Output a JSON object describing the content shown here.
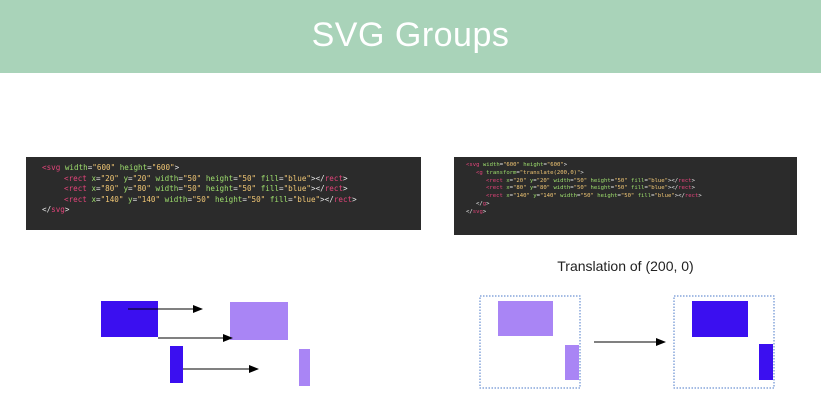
{
  "header": {
    "title": "SVG Groups"
  },
  "code_left": {
    "lines": [
      {
        "indent": 0,
        "tokens": [
          [
            "tag",
            "<svg "
          ],
          [
            "attr",
            "width"
          ],
          [
            "plain",
            "="
          ],
          [
            "val",
            "\"600\""
          ],
          [
            "plain",
            " "
          ],
          [
            "attr",
            "height"
          ],
          [
            "plain",
            "="
          ],
          [
            "val",
            "\"600\""
          ],
          [
            "plain",
            ">"
          ]
        ]
      },
      {
        "indent": 1,
        "tokens": [
          [
            "tag",
            "<rect "
          ],
          [
            "attr",
            "x"
          ],
          [
            "plain",
            "="
          ],
          [
            "val",
            "\"20\""
          ],
          [
            "plain",
            " "
          ],
          [
            "attr",
            "y"
          ],
          [
            "plain",
            "="
          ],
          [
            "val",
            "\"20\""
          ],
          [
            "plain",
            " "
          ],
          [
            "attr",
            "width"
          ],
          [
            "plain",
            "="
          ],
          [
            "val",
            "\"50\""
          ],
          [
            "plain",
            " "
          ],
          [
            "attr",
            "height"
          ],
          [
            "plain",
            "="
          ],
          [
            "val",
            "\"50\""
          ],
          [
            "plain",
            " "
          ],
          [
            "attr",
            "fill"
          ],
          [
            "plain",
            "="
          ],
          [
            "val",
            "\"blue\""
          ],
          [
            "plain",
            "></"
          ],
          [
            "tag",
            "rect"
          ],
          [
            "plain",
            ">"
          ]
        ]
      },
      {
        "indent": 1,
        "tokens": [
          [
            "tag",
            "<rect "
          ],
          [
            "attr",
            "x"
          ],
          [
            "plain",
            "="
          ],
          [
            "val",
            "\"80\""
          ],
          [
            "plain",
            " "
          ],
          [
            "attr",
            "y"
          ],
          [
            "plain",
            "="
          ],
          [
            "val",
            "\"80\""
          ],
          [
            "plain",
            " "
          ],
          [
            "attr",
            "width"
          ],
          [
            "plain",
            "="
          ],
          [
            "val",
            "\"50\""
          ],
          [
            "plain",
            " "
          ],
          [
            "attr",
            "height"
          ],
          [
            "plain",
            "="
          ],
          [
            "val",
            "\"50\""
          ],
          [
            "plain",
            " "
          ],
          [
            "attr",
            "fill"
          ],
          [
            "plain",
            "="
          ],
          [
            "val",
            "\"blue\""
          ],
          [
            "plain",
            "></"
          ],
          [
            "tag",
            "rect"
          ],
          [
            "plain",
            ">"
          ]
        ]
      },
      {
        "indent": 1,
        "tokens": [
          [
            "tag",
            "<rect "
          ],
          [
            "attr",
            "x"
          ],
          [
            "plain",
            "="
          ],
          [
            "val",
            "\"140\""
          ],
          [
            "plain",
            " "
          ],
          [
            "attr",
            "y"
          ],
          [
            "plain",
            "="
          ],
          [
            "val",
            "\"140\""
          ],
          [
            "plain",
            " "
          ],
          [
            "attr",
            "width"
          ],
          [
            "plain",
            "="
          ],
          [
            "val",
            "\"50\""
          ],
          [
            "plain",
            " "
          ],
          [
            "attr",
            "height"
          ],
          [
            "plain",
            "="
          ],
          [
            "val",
            "\"50\""
          ],
          [
            "plain",
            " "
          ],
          [
            "attr",
            "fill"
          ],
          [
            "plain",
            "="
          ],
          [
            "val",
            "\"blue\""
          ],
          [
            "plain",
            "></"
          ],
          [
            "tag",
            "rect"
          ],
          [
            "plain",
            ">"
          ]
        ]
      },
      {
        "indent": 0,
        "tokens": [
          [
            "plain",
            "</"
          ],
          [
            "tag",
            "svg"
          ],
          [
            "plain",
            ">"
          ]
        ]
      }
    ]
  },
  "code_right": {
    "lines": [
      {
        "indent": 0,
        "tokens": [
          [
            "tag",
            "<svg "
          ],
          [
            "attr",
            "width"
          ],
          [
            "plain",
            "="
          ],
          [
            "val",
            "\"600\""
          ],
          [
            "plain",
            " "
          ],
          [
            "attr",
            "height"
          ],
          [
            "plain",
            "="
          ],
          [
            "val",
            "\"600\""
          ],
          [
            "plain",
            ">"
          ]
        ]
      },
      {
        "indent": 1,
        "tokens": [
          [
            "tag",
            "<g "
          ],
          [
            "attr",
            "transform"
          ],
          [
            "plain",
            "="
          ],
          [
            "val",
            "\"translate(200,0)\""
          ],
          [
            "plain",
            ">"
          ]
        ]
      },
      {
        "indent": 2,
        "tokens": [
          [
            "tag",
            "<rect "
          ],
          [
            "attr",
            "x"
          ],
          [
            "plain",
            "="
          ],
          [
            "val",
            "\"20\""
          ],
          [
            "plain",
            " "
          ],
          [
            "attr",
            "y"
          ],
          [
            "plain",
            "="
          ],
          [
            "val",
            "\"20\""
          ],
          [
            "plain",
            " "
          ],
          [
            "attr",
            "width"
          ],
          [
            "plain",
            "="
          ],
          [
            "val",
            "\"50\""
          ],
          [
            "plain",
            " "
          ],
          [
            "attr",
            "height"
          ],
          [
            "plain",
            "="
          ],
          [
            "val",
            "\"50\""
          ],
          [
            "plain",
            " "
          ],
          [
            "attr",
            "fill"
          ],
          [
            "plain",
            "="
          ],
          [
            "val",
            "\"blue\""
          ],
          [
            "plain",
            "></"
          ],
          [
            "tag",
            "rect"
          ],
          [
            "plain",
            ">"
          ]
        ]
      },
      {
        "indent": 2,
        "tokens": [
          [
            "tag",
            "<rect "
          ],
          [
            "attr",
            "x"
          ],
          [
            "plain",
            "="
          ],
          [
            "val",
            "\"80\""
          ],
          [
            "plain",
            " "
          ],
          [
            "attr",
            "y"
          ],
          [
            "plain",
            "="
          ],
          [
            "val",
            "\"80\""
          ],
          [
            "plain",
            " "
          ],
          [
            "attr",
            "width"
          ],
          [
            "plain",
            "="
          ],
          [
            "val",
            "\"50\""
          ],
          [
            "plain",
            " "
          ],
          [
            "attr",
            "height"
          ],
          [
            "plain",
            "="
          ],
          [
            "val",
            "\"50\""
          ],
          [
            "plain",
            " "
          ],
          [
            "attr",
            "fill"
          ],
          [
            "plain",
            "="
          ],
          [
            "val",
            "\"blue\""
          ],
          [
            "plain",
            "></"
          ],
          [
            "tag",
            "rect"
          ],
          [
            "plain",
            ">"
          ]
        ]
      },
      {
        "indent": 2,
        "tokens": [
          [
            "tag",
            "<rect "
          ],
          [
            "attr",
            "x"
          ],
          [
            "plain",
            "="
          ],
          [
            "val",
            "\"140\""
          ],
          [
            "plain",
            " "
          ],
          [
            "attr",
            "y"
          ],
          [
            "plain",
            "="
          ],
          [
            "val",
            "\"140\""
          ],
          [
            "plain",
            " "
          ],
          [
            "attr",
            "width"
          ],
          [
            "plain",
            "="
          ],
          [
            "val",
            "\"50\""
          ],
          [
            "plain",
            " "
          ],
          [
            "attr",
            "height"
          ],
          [
            "plain",
            "="
          ],
          [
            "val",
            "\"50\""
          ],
          [
            "plain",
            " "
          ],
          [
            "attr",
            "fill"
          ],
          [
            "plain",
            "="
          ],
          [
            "val",
            "\"blue\""
          ],
          [
            "plain",
            "></"
          ],
          [
            "tag",
            "rect"
          ],
          [
            "plain",
            ">"
          ]
        ]
      },
      {
        "indent": 1,
        "tokens": [
          [
            "plain",
            "</"
          ],
          [
            "tag",
            "g"
          ],
          [
            "plain",
            ">"
          ]
        ]
      },
      {
        "indent": 0,
        "tokens": [
          [
            "plain",
            "</"
          ],
          [
            "tag",
            "svg"
          ],
          [
            "plain",
            ">"
          ]
        ]
      }
    ]
  },
  "caption": "Translation of (200, 0)",
  "colors": {
    "header_bg": "#a9d3b9",
    "solid_rect": "#3b0ff0",
    "ghost_rect": "#a985f5",
    "arrow": "#000000",
    "frame": "#4a78c8"
  }
}
